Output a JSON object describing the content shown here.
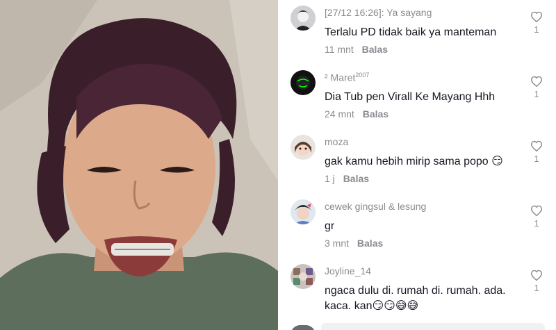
{
  "video": {
    "description_icon": "person-face-image"
  },
  "comments": [
    {
      "username": "[27/12 16:26]: Ya sayang",
      "sup": "",
      "text": "Terlalu PD tidak baik ya manteman",
      "time": "11 mnt",
      "reply": "Balas",
      "likes": "1"
    },
    {
      "username": "² Maret",
      "sup": "2007",
      "text": "Dia Tub pen Virall Ke Mayang Hhh",
      "time": "24 mnt",
      "reply": "Balas",
      "likes": "1"
    },
    {
      "username": "moza",
      "sup": "",
      "text": "gak kamu hebih mirip sama popo 😏",
      "time": "1 j",
      "reply": "Balas",
      "likes": "1"
    },
    {
      "username": "cewek gingsul & lesung",
      "sup": "",
      "text": "gr",
      "time": "3 mnt",
      "reply": "Balas",
      "likes": "1"
    },
    {
      "username": "Joyline_14",
      "sup": "",
      "text": "ngaca dulu di. rumah di. rumah. ada. kaca. kan😏😏😅😅",
      "time": "",
      "reply": "",
      "likes": "1"
    }
  ],
  "colors": {
    "meta": "#8a8b91",
    "text": "#161823"
  }
}
